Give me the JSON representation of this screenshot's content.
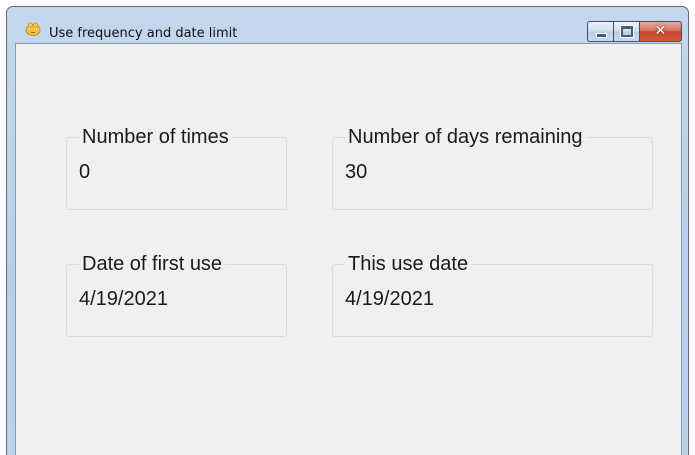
{
  "window": {
    "title": "Use frequency and date limit",
    "app_icon": "smiley-app-icon",
    "controls": {
      "minimize": "minimize-icon",
      "maximize": "maximize-icon",
      "close": "close-icon"
    }
  },
  "groups": {
    "times": {
      "label": "Number of times",
      "value": "0"
    },
    "days": {
      "label": "Number of days remaining",
      "value": "30"
    },
    "first_use": {
      "label": "Date of first use",
      "value": "4/19/2021"
    },
    "this_use": {
      "label": "This use date",
      "value": "4/19/2021"
    }
  },
  "colors": {
    "titlebar": "#c4d7ee",
    "client_bg": "#f0f0f0",
    "close_button": "#c3462d"
  }
}
